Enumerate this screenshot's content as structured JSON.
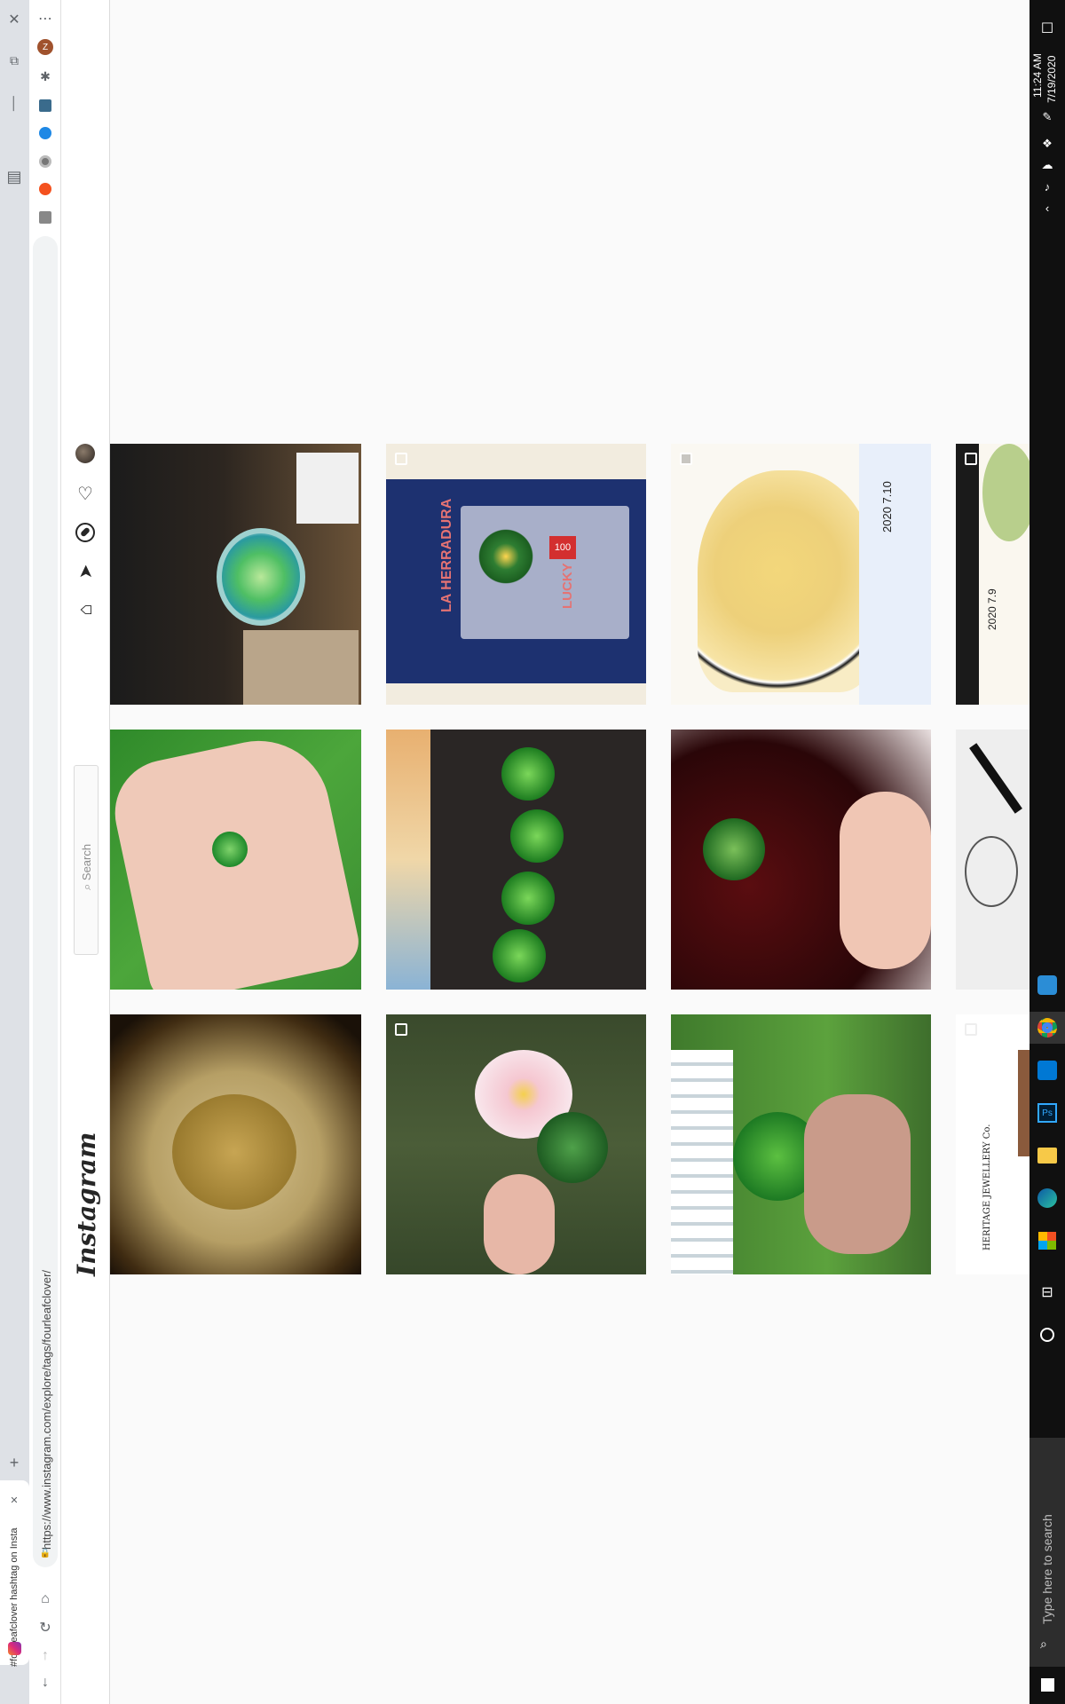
{
  "browser": {
    "tab_title": "#fourleafclover hashtag on Insta",
    "url": "https://www.instagram.com/explore/tags/fourleafclover/",
    "tab_close": "✕",
    "new_tab": "+",
    "menu": "⋯"
  },
  "instagram": {
    "logo": "Instagram",
    "search_placeholder": "Search",
    "nav_icons": [
      "home-icon",
      "direct-icon",
      "explore-icon",
      "activity-icon",
      "profile-avatar"
    ]
  },
  "posts": [
    {
      "id": "p1",
      "desc": "glass bowl with beads",
      "multi": false
    },
    {
      "id": "p2",
      "desc": "LA HERRADURA felt banner",
      "multi": true
    },
    {
      "id": "p3",
      "desc": "soup painting",
      "multi": true
    },
    {
      "id": "p4",
      "desc": "watercolor partial",
      "multi": true
    },
    {
      "id": "p5",
      "desc": "clover in hand",
      "multi": false
    },
    {
      "id": "p6",
      "desc": "clovers on black",
      "multi": false
    },
    {
      "id": "p7",
      "desc": "clover held up",
      "multi": false
    },
    {
      "id": "p8",
      "desc": "sketch",
      "multi": false
    },
    {
      "id": "p9",
      "desc": "pressed clover magnified",
      "multi": false
    },
    {
      "id": "p10",
      "desc": "flower and clover",
      "multi": true
    },
    {
      "id": "p11",
      "desc": "clover near fence",
      "multi": false
    },
    {
      "id": "p12",
      "desc": "heritage jewellery",
      "multi": true
    }
  ],
  "banner_text": {
    "herradura": "LA HERRADURA",
    "lucky": "LUCKY",
    "hundred": "100",
    "painting_date": "2020 7.10",
    "painting_date2": "2020 7.9",
    "heritage": "HERITAGE JEWELLERY Co."
  },
  "taskbar": {
    "time": "11:24 AM",
    "date": "7/19/2020",
    "search_placeholder": "Type here to search"
  }
}
